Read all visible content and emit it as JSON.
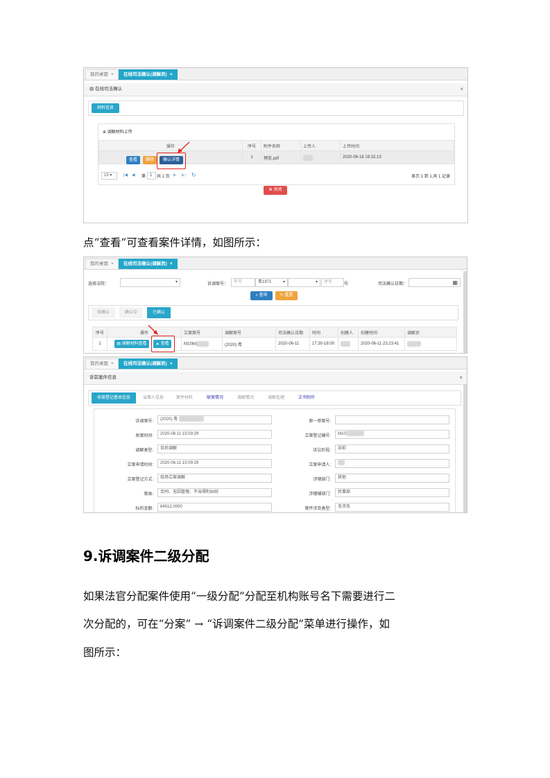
{
  "shot1": {
    "tabs": [
      "我的桌面",
      "在线司法确认(调解员)"
    ],
    "panel_title": "在线司法确认",
    "section_tab": "材料信息",
    "upload_label": "调解材料上传",
    "table": {
      "headers": [
        "操作",
        "序号",
        "附件名称",
        "上传人",
        "上传时间"
      ],
      "row": {
        "btn_view": "查看",
        "btn_delete": "删除",
        "btn_confirm": "确认详情",
        "index": "1",
        "file": "预见.pdf",
        "time": "2020-06-18 18:15:13"
      }
    },
    "pager": {
      "size": "15",
      "page_prefix": "第",
      "page_value": "1",
      "page_suffix": "共 1 页",
      "summary": "显示 1 到 1,共 1 记录"
    },
    "close_button": "关闭"
  },
  "para1": "点“查看”可查看案件详情，如图所示：",
  "shot2": {
    "tabs": [
      "我的桌面",
      "在线司法确认(调解员)"
    ],
    "court_label": "选择法院：",
    "case_label": "诉调案号：",
    "year_placeholder": "年号",
    "code_value": "粤1971",
    "seq_placeholder": "序号",
    "hao": "号",
    "date_label": "司法确认日期：",
    "search_btn": "查询",
    "reset_btn": "重置",
    "status_tabs": [
      "待确认",
      "确认中",
      "已确认"
    ],
    "table": {
      "headers": [
        "序号",
        "操作",
        "立案案号",
        "调解案号",
        "司法确认日期",
        "时间",
        "创建人",
        "创建时间",
        "调解员"
      ],
      "row": {
        "index": "1",
        "btn_material": "调解材料查看",
        "btn_view": "查看",
        "case_no": "M1084",
        "mediation_no": "(2020) 粤",
        "date": "2020-06-11",
        "time": "17:30-18:00",
        "created": "2020-06-11 23:23:41"
      }
    }
  },
  "shot3": {
    "tabs": [
      "我的桌面",
      "在线司法确认(调解员)"
    ],
    "panel_title": "诉前案件信息",
    "subtabs": [
      "收案登记基本信息",
      "当事人信息",
      "案件材料",
      "联案情况",
      "调解情况",
      "调解处理",
      "文书制作"
    ],
    "left_labels": [
      "诉调案号:",
      "收案时间:",
      "调解类型:",
      "立案申请时间:",
      "立案登记方式:",
      "案由:",
      "标的金额:"
    ],
    "left_values": [
      "(2020) 粤",
      "2020-06-11 15:09:29",
      "诉后调解",
      "2020-06-11 15:09:29",
      "现场立案调解",
      "合同、无因管理、不当得利纠纷",
      "84512.0000"
    ],
    "right_labels": [
      "原一审案号:",
      "立案登记编号:",
      "诉讼阶段:",
      "立案申请人:",
      "涉辖部门:",
      "涉辖辅部门:",
      "案件涉及类型:"
    ],
    "right_values": [
      "",
      "M10",
      "诉前",
      "",
      "其他",
      "民事部",
      "无涉及"
    ]
  },
  "heading": "9.诉调案件二级分配",
  "para2_lines": [
    "如果法官分配案件使用“一级分配”分配至机构账号名下需要进行二",
    "次分配的，可在“分案” → “诉调案件二级分配”菜单进行操作，如",
    "图所示："
  ],
  "colors": {
    "accent": "#23a6c9",
    "primary": "#2f7fc1",
    "warning": "#f0a33c",
    "danger": "#e24d4d",
    "annotation": "#e02020"
  }
}
